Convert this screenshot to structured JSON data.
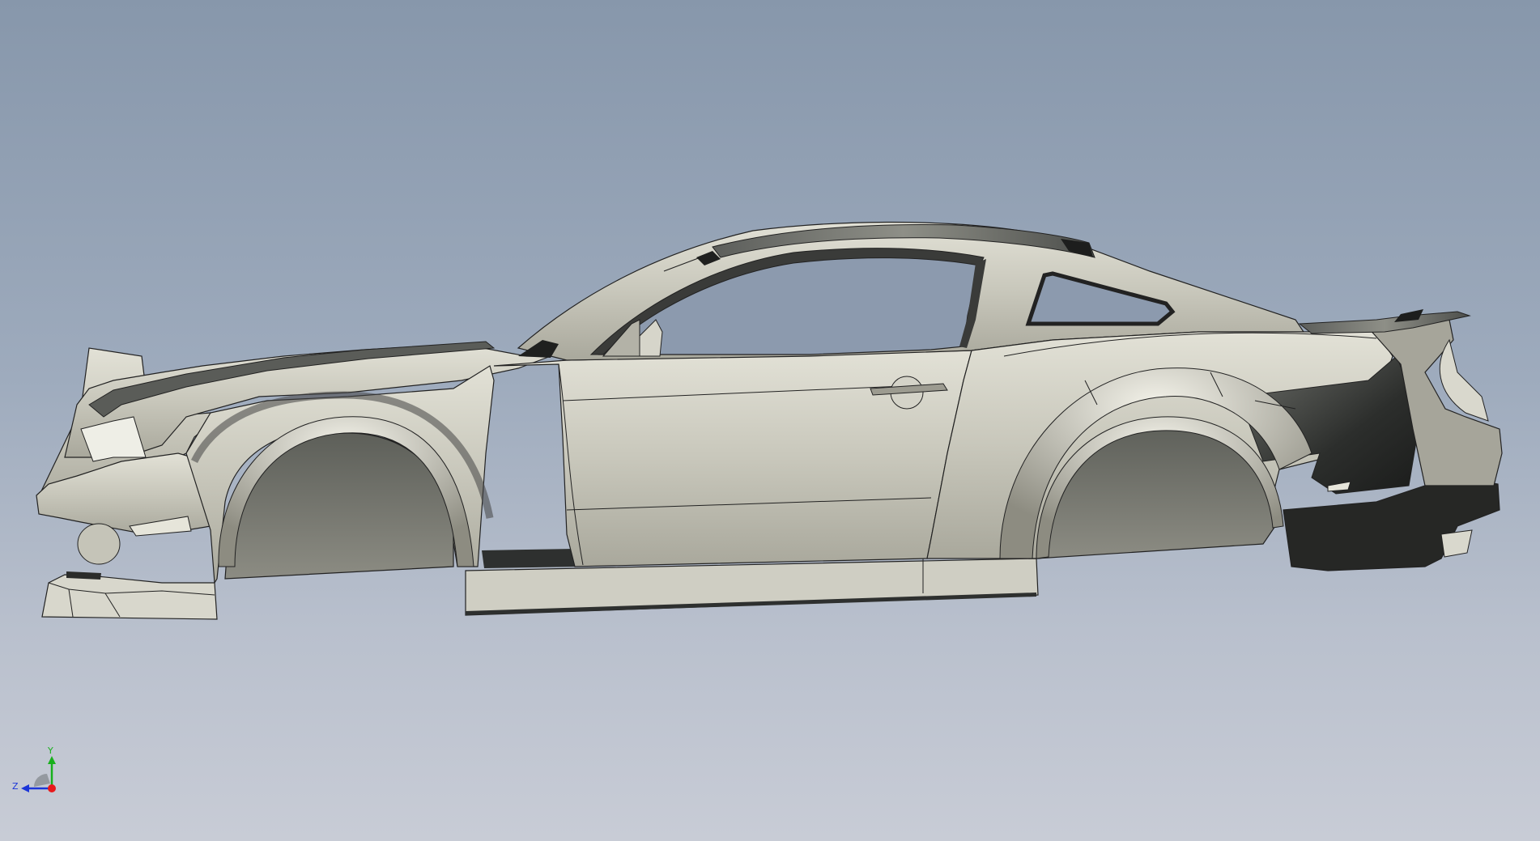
{
  "viewport": {
    "background_top": "#8797ab",
    "background_bottom": "#c8ccd6"
  },
  "model": {
    "part_color": "#c9c8bc",
    "dark_trim_color": "#2e302f",
    "edge_color": "#222222"
  },
  "triad": {
    "x_axis": {
      "color": "#e8191b"
    },
    "y_axis": {
      "label": "Y",
      "color": "#18b01c"
    },
    "z_axis": {
      "label": "Z",
      "color": "#1b35d8"
    }
  }
}
